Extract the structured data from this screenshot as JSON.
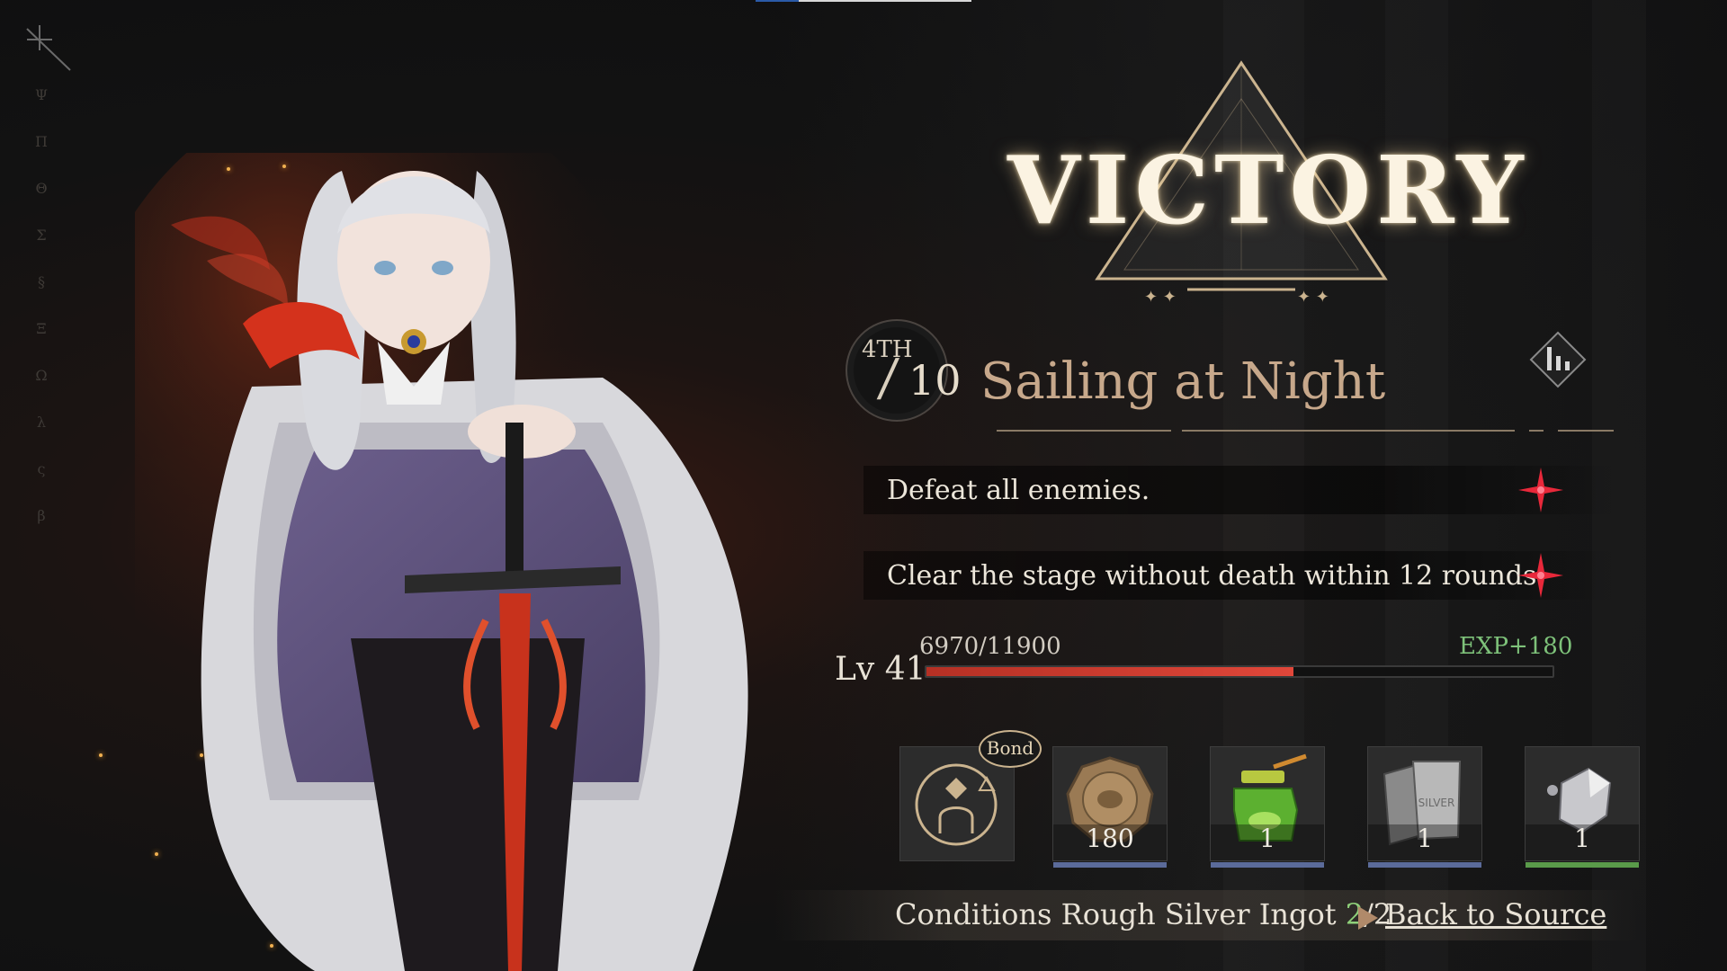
{
  "victory": {
    "title": "VICTORY"
  },
  "stage": {
    "rank": "4TH",
    "slash": "/",
    "total": "10",
    "title": "Sailing at Night"
  },
  "objectives": [
    {
      "text": "Defeat all enemies."
    },
    {
      "text": "Clear the stage without death within 12 rounds"
    }
  ],
  "level": {
    "label": "Lv 41",
    "exp_current": "6970/11900",
    "exp_gain": "EXP+180",
    "exp_fraction": 0.586
  },
  "rewards": {
    "bond_tag": "Bond",
    "items": [
      {
        "icon": "coin-icon",
        "quantity": "180",
        "rarity_color": "#5b6b9a"
      },
      {
        "icon": "potion-jar-icon",
        "quantity": "1",
        "rarity_color": "#5b6b9a"
      },
      {
        "icon": "silver-ingot-icon",
        "quantity": "1",
        "rarity_color": "#5b6b9a"
      },
      {
        "icon": "silver-ore-icon",
        "quantity": "1",
        "rarity_color": "#5a9a4a"
      }
    ]
  },
  "condition": {
    "prefix": "Conditions Rough Silver Ingot ",
    "count": "2",
    "total": "/2",
    "back_link": "Back to Source"
  },
  "colors": {
    "accent_gold": "#cbb48f",
    "exp_bar": "#d9443a",
    "exp_gain": "#7ec27a",
    "objective_star": "#e8283a"
  }
}
